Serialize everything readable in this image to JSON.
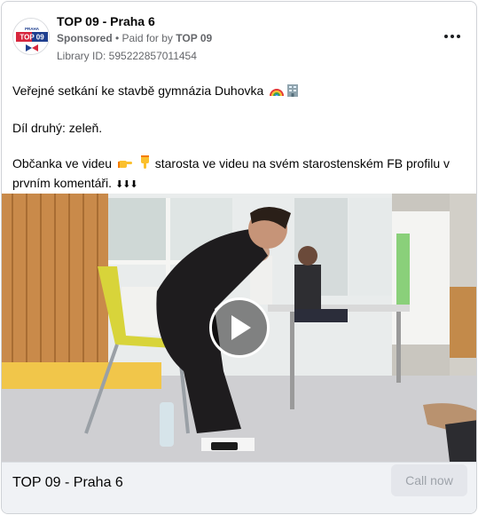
{
  "header": {
    "page_name": "TOP 09 - Praha 6",
    "sponsored_label": "Sponsored",
    "separator": " • ",
    "paid_for_prefix": "Paid for by ",
    "paid_for_name": "TOP 09",
    "library_id": "Library ID: 595222857011454",
    "more_icon": "more-horizontal-icon"
  },
  "logo": {
    "top_text": "PRAHA",
    "main_text": "TOP 09",
    "colors": {
      "blue": "#1f3f8f",
      "red": "#d7263d"
    }
  },
  "post": {
    "line1": "Veřejné setkání ke stavbě gymnázia Duhovka",
    "line2": "Díl druhý: zeleň.",
    "line3a": "Občanka ve videu",
    "line3b": "starosta ve videu na svém starostenském FB profilu v prvním komentáři.",
    "arrows": "⬇⬇⬇",
    "icons": [
      "rainbow-icon",
      "office-building-icon",
      "point-right-hand-icon",
      "point-down-hand-icon"
    ]
  },
  "video": {
    "play_icon": "play-icon"
  },
  "footer": {
    "page_name": "TOP 09 - Praha 6",
    "cta_label": "Call now"
  }
}
